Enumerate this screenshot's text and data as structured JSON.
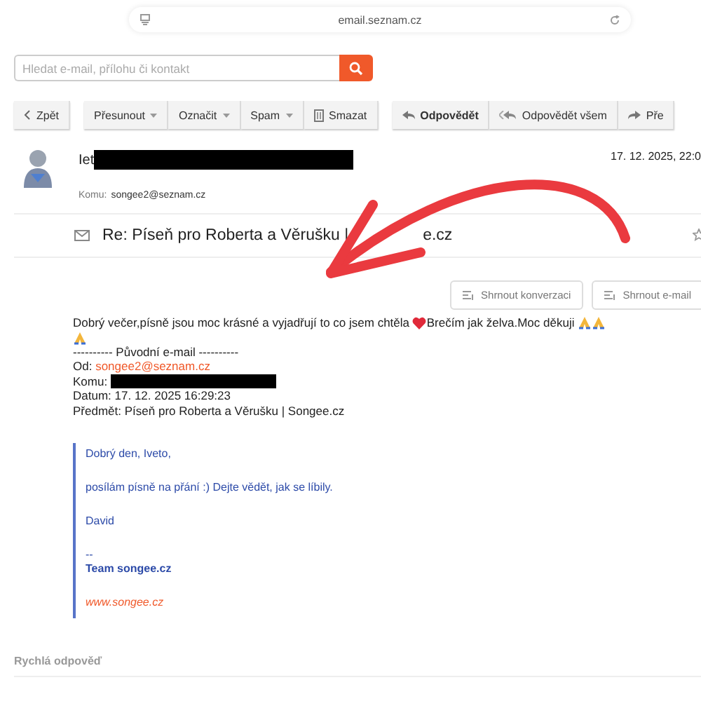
{
  "browser": {
    "url": "email.seznam.cz"
  },
  "search": {
    "placeholder": "Hledat e-mail, přílohu či kontakt"
  },
  "toolbar": [
    {
      "label": "Zpět",
      "kind": "back"
    },
    {
      "label": "Přesunout",
      "kind": "dropdown"
    },
    {
      "label": "Označit",
      "kind": "dropdown"
    },
    {
      "label": "Spam",
      "kind": "dropdown"
    },
    {
      "label": "Smazat",
      "kind": "delete"
    },
    {
      "label": "Odpovědět",
      "kind": "reply"
    },
    {
      "label": "Odpovědět všem",
      "kind": "reply_all"
    },
    {
      "label": "Pře",
      "kind": "forward"
    }
  ],
  "message": {
    "sender": "Iet",
    "sender_redacted": true,
    "date": "17. 12. 2025, 22:0",
    "to_label": "Komu:",
    "to": "songee2@seznam.cz",
    "subject": "Re: Píseň pro Roberta a Věrušku |",
    "subject_tail": "e.cz",
    "starred": false,
    "summary_buttons": [
      {
        "label": "Shrnout konverzaci"
      },
      {
        "label": "Shrnout e-mail"
      }
    ],
    "body": {
      "text_before_heart": "Dobrý večer,písně jsou moc krásné a vyjadřují to co jsem chtěla",
      "text_after_heart": "Brečím jak želva.Moc děkuji"
    },
    "original": {
      "divider": "---------- Původní e-mail ----------",
      "fields": [
        {
          "label": "Od:",
          "value": "songee2@seznam.cz",
          "kind": "link"
        },
        {
          "label": "Komu:",
          "kind": "redacted"
        },
        {
          "label": "Datum:",
          "value": "17. 12. 2025 16:29:23",
          "kind": "text"
        },
        {
          "label": "Předmět:",
          "value": "Píseň pro Roberta a Věrušku | Songee.cz",
          "kind": "text"
        }
      ]
    },
    "quote": {
      "greeting": "Dobrý den, Iveto,",
      "line": "posílám písně na přání :) Dejte vědět, jak se líbily.",
      "name": "David",
      "dash": "--",
      "team": "Team songee.cz",
      "website": "www.songee.cz"
    }
  },
  "quick_reply": {
    "title": "Rychlá odpověď"
  }
}
